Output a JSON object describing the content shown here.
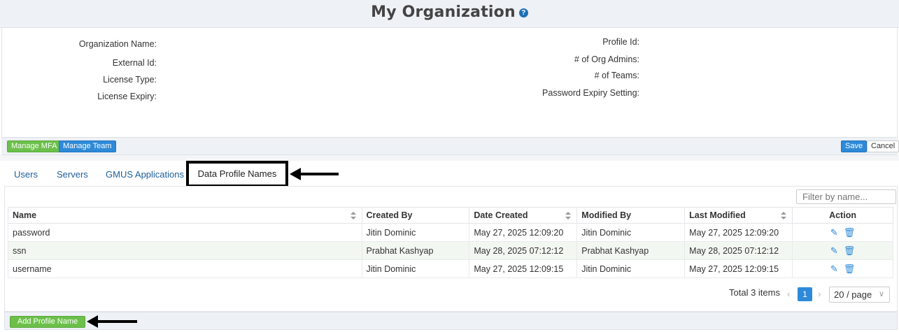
{
  "header": {
    "title": "My Organization",
    "help_icon": "?"
  },
  "org_info": {
    "left": [
      "Organization Name:",
      "External Id:",
      "License Type:",
      "License Expiry:"
    ],
    "right": [
      "Profile Id:",
      "# of Org Admins:",
      "# of Teams:",
      "Password Expiry Setting:"
    ]
  },
  "actions": {
    "manage_mfa": "Manage MFA",
    "manage_team": "Manage Team",
    "save": "Save",
    "cancel": "Cancel"
  },
  "tabs": [
    {
      "label": "Users"
    },
    {
      "label": "Servers"
    },
    {
      "label": "GMUS Applications"
    },
    {
      "label": "Data Profile Names",
      "active": true
    }
  ],
  "filter": {
    "placeholder": "Filter by name..."
  },
  "table": {
    "headers": [
      "Name",
      "Created By",
      "Date Created",
      "Modified By",
      "Last Modified",
      "Action"
    ],
    "rows": [
      {
        "name": "password",
        "created_by": "Jitin Dominic",
        "date_created": "May 27, 2025 12:09:20",
        "modified_by": "Jitin Dominic",
        "last_modified": "May 27, 2025 12:09:20"
      },
      {
        "name": "ssn",
        "created_by": "Prabhat Kashyap",
        "date_created": "May 28, 2025 07:12:12",
        "modified_by": "Prabhat Kashyap",
        "last_modified": "May 28, 2025 07:12:12"
      },
      {
        "name": "username",
        "created_by": "Jitin Dominic",
        "date_created": "May 27, 2025 12:09:15",
        "modified_by": "Jitin Dominic",
        "last_modified": "May 27, 2025 12:09:15"
      }
    ]
  },
  "pagination": {
    "total": "Total 3 items",
    "current_page": "1",
    "per_page": "20 / page"
  },
  "bottom": {
    "add_profile": "Add Profile Name"
  },
  "colors": {
    "accent_blue": "#2e8ad8",
    "accent_green": "#6cc04a",
    "link": "#1e5f99"
  },
  "icons": {
    "edit": "pencil-icon",
    "delete": "trash-icon",
    "help": "question-circle-icon",
    "annotation": "arrow-left-icon"
  }
}
